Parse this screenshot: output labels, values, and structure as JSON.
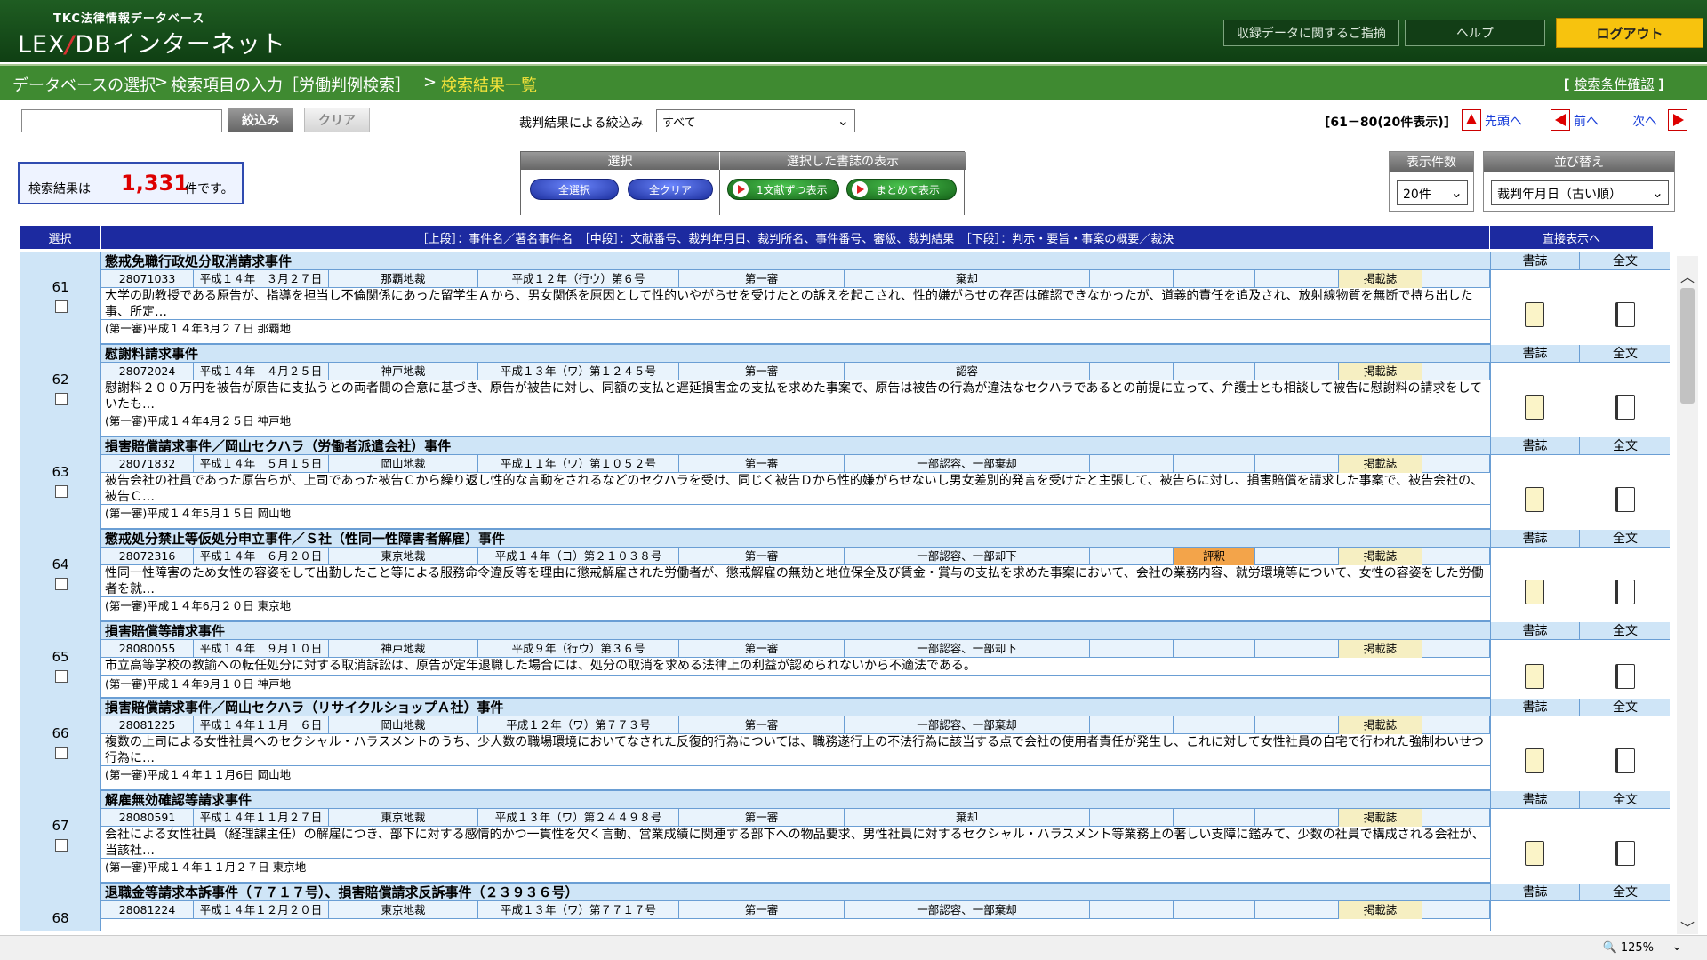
{
  "header": {
    "subtitle": "TKC法律情報データベース",
    "logo_left": "LEX",
    "logo_slash": "/",
    "logo_right": "DBインターネット",
    "feedback": "収録データに関するご指摘",
    "help": "ヘルプ",
    "logout": "ログアウト"
  },
  "breadcrumb": {
    "db": "データベースの選択",
    "sep": ">",
    "input": "検索項目の入力［労働判例検索］",
    "current": "検索結果一覧",
    "confirm": "検索条件確認",
    "confirm_open": "[",
    "confirm_close": "]"
  },
  "filter": {
    "narrow": "絞込み",
    "clear": "クリア",
    "result_label": "裁判結果による絞込み",
    "result_value": "すべて"
  },
  "pager": {
    "range": "[61－80(20件表示)]",
    "first": "先頭へ",
    "prev": "前へ",
    "next": "次へ"
  },
  "count": {
    "prefix": "検索結果は",
    "value": "1,331",
    "suffix": "件です。"
  },
  "select_panel": {
    "title": "選択",
    "select_all": "全選択",
    "clear_all": "全クリア"
  },
  "display_panel": {
    "title": "選択した書誌の表示",
    "one_by_one": "1文献ずつ表示",
    "all_together": "まとめて表示"
  },
  "per_page": {
    "title": "表示件数",
    "value": "20件"
  },
  "sort": {
    "title": "並び替え",
    "value": "裁判年月日（古い順）"
  },
  "table_header": {
    "select": "選択",
    "main": "［上段］：事件名／著名事件名　［中段］：文献番号、裁判年月日、裁判所名、事件番号、審級、裁判結果　［下段］：判示・要旨・事案の概要／裁決",
    "direct": "直接表示へ"
  },
  "side_labels": {
    "biblio": "書誌",
    "fulltext": "全文"
  },
  "records": [
    {
      "no": "61",
      "title": "懲戒免職行政処分取消請求事件",
      "doc": "28071033",
      "date": "平成１４年　３月２７日",
      "court": "那覇地裁",
      "case": "平成１２年（行ウ）第６号",
      "level": "第一審",
      "result": "棄却",
      "note": "",
      "pub": "掲載誌",
      "summary": "大学の助教授である原告が、指導を担当し不倫関係にあった留学生Ａから、男女関係を原因として性的いやがらせを受けたとの訴えを起こされ、性的嫌がらせの存否は確認できなかったが、道義的責任を追及され、放射線物質を無断で持ち出した事、所定…",
      "foot": "(第一審)平成１４年3月２７日 那覇地"
    },
    {
      "no": "62",
      "title": "慰謝料請求事件",
      "doc": "28072024",
      "date": "平成１４年　４月２５日",
      "court": "神戸地裁",
      "case": "平成１３年（ワ）第１２４５号",
      "level": "第一審",
      "result": "認容",
      "note": "",
      "pub": "掲載誌",
      "summary": "慰謝料２００万円を被告が原告に支払うとの両者間の合意に基づき、原告が被告に対し、同額の支払と遅延損害金の支払を求めた事案で、原告は被告の行為が違法なセクハラであるとの前提に立って、弁護士とも相談して被告に慰謝料の請求をしていたも…",
      "foot": "(第一審)平成１４年4月２５日 神戸地"
    },
    {
      "no": "63",
      "title": "損害賠償請求事件／岡山セクハラ（労働者派遣会社）事件",
      "doc": "28071832",
      "date": "平成１４年　５月１５日",
      "court": "岡山地裁",
      "case": "平成１１年（ワ）第１０５２号",
      "level": "第一審",
      "result": "一部認容、一部棄却",
      "note": "",
      "pub": "掲載誌",
      "summary": "被告会社の社員であった原告らが、上司であった被告Ｃから繰り返し性的な言動をされるなどのセクハラを受け、同じく被告Ｄから性的嫌がらせないし男女差別的発言を受けたと主張して、被告らに対し、損害賠償を請求した事案で、被告会社の、被告Ｃ…",
      "foot": "(第一審)平成１４年5月１５日 岡山地"
    },
    {
      "no": "64",
      "title": "懲戒処分禁止等仮処分申立事件／Ｓ社（性同一性障害者解雇）事件",
      "doc": "28072316",
      "date": "平成１４年　６月２０日",
      "court": "東京地裁",
      "case": "平成１４年（ヨ）第２１０３８号",
      "level": "第一審",
      "result": "一部認容、一部却下",
      "note": "評釈",
      "pub": "掲載誌",
      "summary": "性同一性障害のため女性の容姿をして出勤したこと等による服務命令違反等を理由に懲戒解雇された労働者が、懲戒解雇の無効と地位保全及び賃金・賞与の支払を求めた事案において、会社の業務内容、就労環境等について、女性の容姿をした労働者を就…",
      "foot": "(第一審)平成１４年6月２０日 東京地"
    },
    {
      "no": "65",
      "title": "損害賠償等請求事件",
      "doc": "28080055",
      "date": "平成１４年　９月１０日",
      "court": "神戸地裁",
      "case": "平成９年（行ウ）第３６号",
      "level": "第一審",
      "result": "一部認容、一部却下",
      "note": "",
      "pub": "掲載誌",
      "summary": "市立高等学校の教諭への転任処分に対する取消訴訟は、原告が定年退職した場合には、処分の取消を求める法律上の利益が認められないから不適法である。",
      "foot": "(第一審)平成１４年9月１０日 神戸地"
    },
    {
      "no": "66",
      "title": "損害賠償請求事件／岡山セクハラ（リサイクルショップＡ社）事件",
      "doc": "28081225",
      "date": "平成１４年１１月　６日",
      "court": "岡山地裁",
      "case": "平成１２年（ワ）第７７３号",
      "level": "第一審",
      "result": "一部認容、一部棄却",
      "note": "",
      "pub": "掲載誌",
      "summary": "複数の上司による女性社員へのセクシャル・ハラスメントのうち、少人数の職場環境においてなされた反復的行為については、職務遂行上の不法行為に該当する点で会社の使用者責任が発生し、これに対して女性社員の自宅で行われた強制わいせつ行為に…",
      "foot": "(第一審)平成１４年１１月6日 岡山地"
    },
    {
      "no": "67",
      "title": "解雇無効確認等請求事件",
      "doc": "28080591",
      "date": "平成１４年１１月２７日",
      "court": "東京地裁",
      "case": "平成１３年（ワ）第２４４９８号",
      "level": "第一審",
      "result": "棄却",
      "note": "",
      "pub": "掲載誌",
      "summary": "会社による女性社員（経理課主任）の解雇につき、部下に対する感情的かつ一貫性を欠く言動、営業成績に関連する部下への物品要求、男性社員に対するセクシャル・ハラスメント等業務上の著しい支障に鑑みて、少数の社員で構成される会社が、当該社…",
      "foot": "(第一審)平成１４年１１月２７日 東京地"
    },
    {
      "no": "68",
      "title": "退職金等請求本訴事件（７７１７号）、損害賠償請求反訴事件（２３９３６号）",
      "doc": "28081224",
      "date": "平成１４年１２月２０日",
      "court": "東京地裁",
      "case": "平成１３年（ワ）第７７１７号",
      "level": "第一審",
      "result": "一部認容、一部棄却",
      "note": "",
      "pub": "掲載誌",
      "summary": "",
      "foot": ""
    }
  ],
  "statusbar": {
    "zoom": "125%"
  }
}
